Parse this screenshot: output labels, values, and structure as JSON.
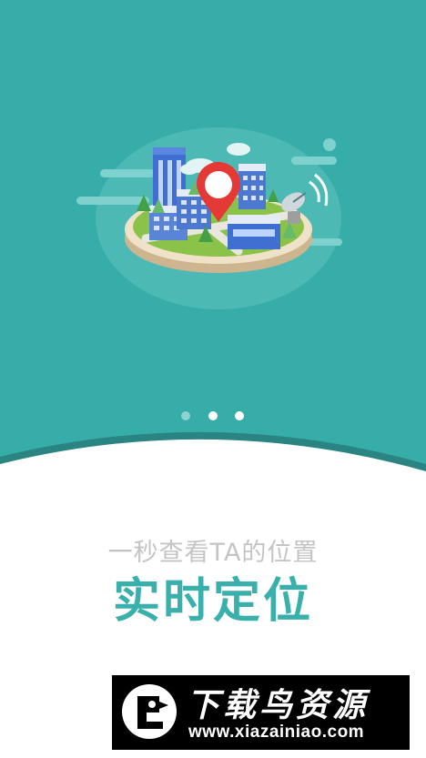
{
  "pager": {
    "count": 3,
    "active_index": 0
  },
  "text": {
    "subtitle": "一秒查看TA的位置",
    "headline": "实时定位"
  },
  "watermark": {
    "title": "下载鸟资源",
    "url": "www.xiazainiao.com"
  },
  "illustration": {
    "icons": [
      "city-island-icon",
      "location-pin-icon",
      "satellite-dish-icon",
      "cloud-icon",
      "tree-icon"
    ]
  },
  "colors": {
    "teal_background": "#36ada9",
    "teal_dark_edge": "#2a8481",
    "headline": "#3ab0ac",
    "subtitle": "#c4c4c4",
    "pin_red": "#e53935"
  }
}
